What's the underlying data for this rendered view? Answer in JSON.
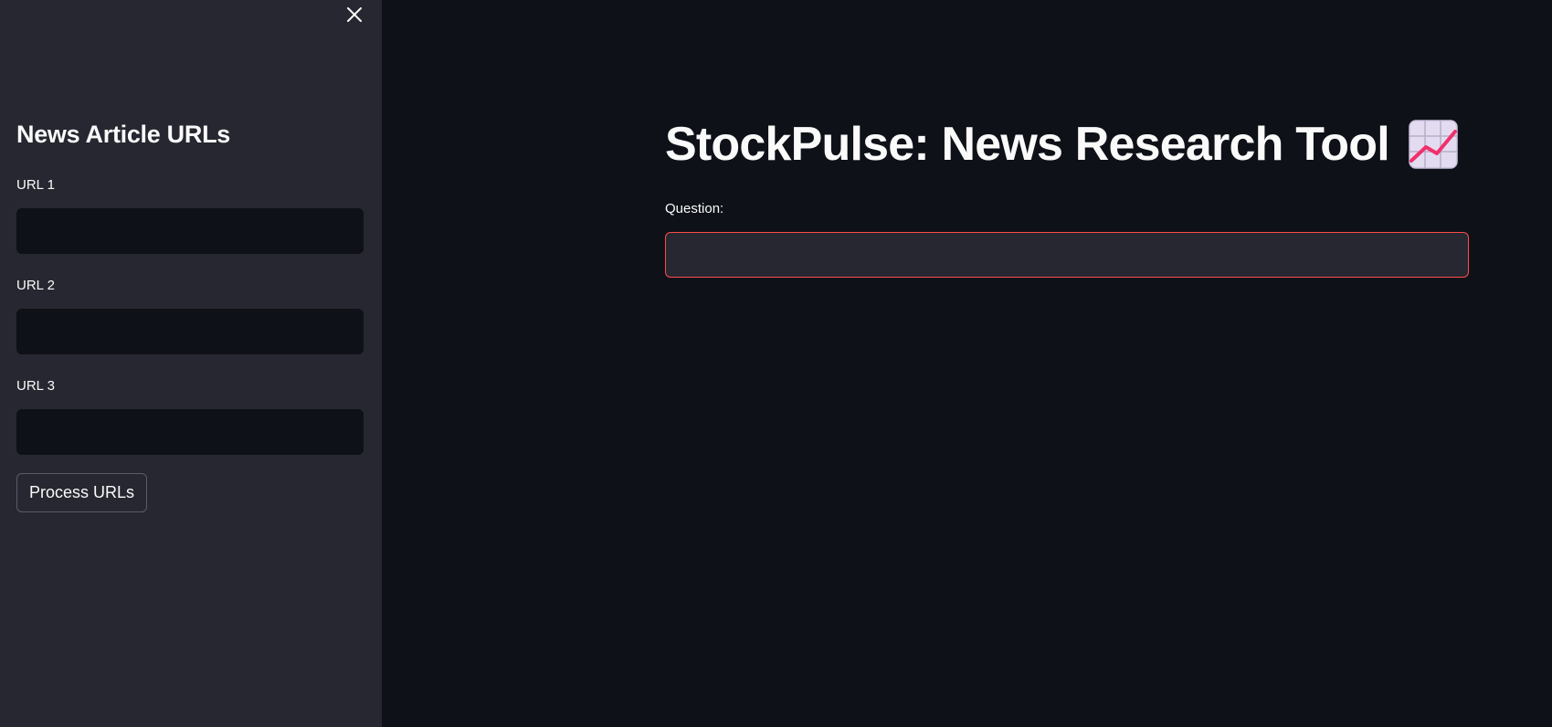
{
  "sidebar": {
    "title": "News Article URLs",
    "close_icon": "close-icon",
    "fields": [
      {
        "label": "URL 1",
        "value": "",
        "placeholder": ""
      },
      {
        "label": "URL 2",
        "value": "",
        "placeholder": ""
      },
      {
        "label": "URL 3",
        "value": "",
        "placeholder": ""
      }
    ],
    "process_button_label": "Process URLs"
  },
  "main": {
    "title": "StockPulse: News Research Tool",
    "title_icon": "chart-increasing-icon",
    "question_label": "Question:",
    "question_value": "",
    "question_placeholder": ""
  },
  "colors": {
    "app_background": "#0e1117",
    "sidebar_background": "#262730",
    "text": "#fafafa",
    "focus_border": "#ff4b4b"
  }
}
